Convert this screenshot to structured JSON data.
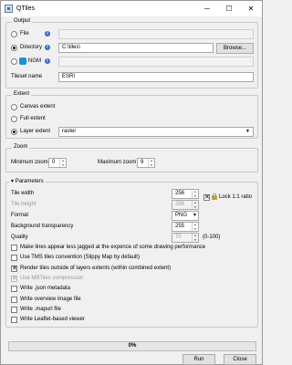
{
  "window": {
    "title": "QTiles",
    "minimize": "─",
    "maximize": "☐",
    "close": "✕"
  },
  "output": {
    "group_title": "Output",
    "file_label": "File",
    "file_value": "",
    "directory_label": "Directory",
    "directory_value": "C:\\tiles\\",
    "browse_label": "Browse...",
    "ngm_label": "NGM",
    "ngm_value": "",
    "tileset_label": "Tileset name",
    "tileset_value": "ESRI",
    "selected": "directory"
  },
  "extent": {
    "group_title": "Extent",
    "canvas_label": "Canvas extent",
    "full_label": "Full extent",
    "layer_label": "Layer extent",
    "layer_value": "raster",
    "selected": "layer"
  },
  "zoom": {
    "group_title": "Zoom",
    "min_label": "Minimum zoom",
    "min_value": "0",
    "max_label": "Maximum zoom",
    "max_value": "9"
  },
  "parameters": {
    "group_title": "Parameters",
    "collapse_glyph": "▾",
    "tile_width_label": "Tile width",
    "tile_width_value": "256",
    "tile_height_label": "Tile height",
    "tile_height_value": "256",
    "lock_label": "Lock 1:1 ratio",
    "lock_checked": true,
    "format_label": "Format",
    "format_value": "PNG",
    "transparency_label": "Background transparency",
    "transparency_value": "255",
    "quality_label": "Quality",
    "quality_value": "70",
    "quality_range": "(0-100)",
    "checkboxes": [
      {
        "label": "Make lines appear less jagged at the expence of some drawing performance",
        "checked": false,
        "disabled": false
      },
      {
        "label": "Use TMS tiles convention (Slippy Map by default)",
        "checked": false,
        "disabled": false
      },
      {
        "label": "Render tiles outside of layers extents (within combined extent)",
        "checked": true,
        "disabled": false
      },
      {
        "label": "Use MBTiles compression",
        "checked": true,
        "disabled": true
      },
      {
        "label": "Write .json metadata",
        "checked": false,
        "disabled": false
      },
      {
        "label": "Write overview image file",
        "checked": false,
        "disabled": false
      },
      {
        "label": "Write .mapurl file",
        "checked": false,
        "disabled": false
      },
      {
        "label": "Write Leaflet-based viewer",
        "checked": false,
        "disabled": false
      }
    ]
  },
  "progress": {
    "text": "0%",
    "value": 0.0
  },
  "footer": {
    "run_label": "Run",
    "close_label": "Close"
  }
}
